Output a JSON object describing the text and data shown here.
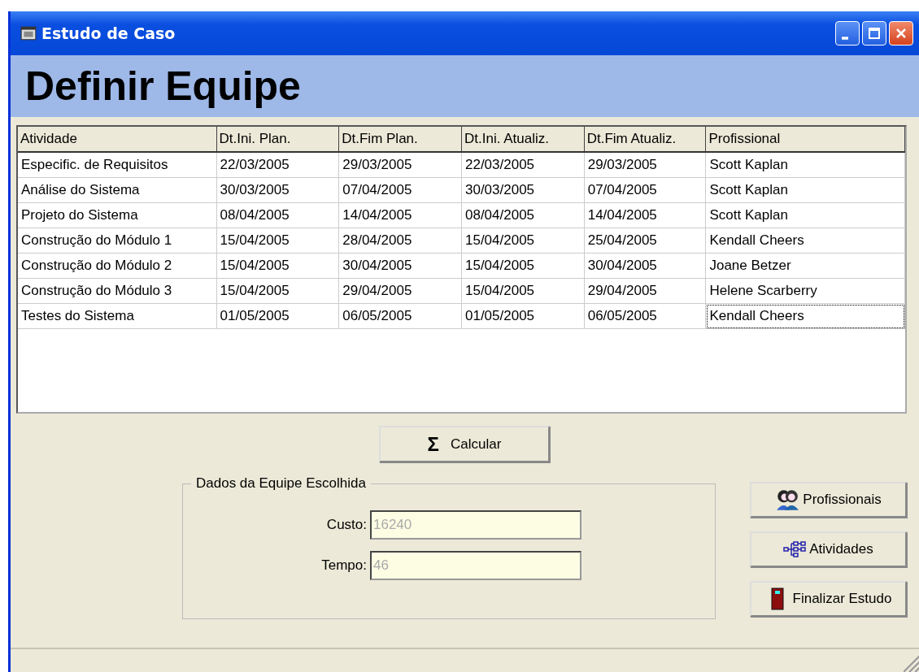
{
  "window": {
    "title": "Estudo de Caso"
  },
  "heading": "Definir Equipe",
  "table": {
    "columns": [
      "Atividade",
      "Dt.Ini. Plan.",
      "Dt.Fim Plan.",
      "Dt.Ini. Atualiz.",
      "Dt.Fim Atualiz.",
      "Profissional"
    ],
    "rows": [
      {
        "cells": [
          "Especific. de Requisitos",
          "22/03/2005",
          "29/03/2005",
          "22/03/2005",
          "29/03/2005",
          "Scott Kaplan"
        ],
        "focused": false
      },
      {
        "cells": [
          "Análise do Sistema",
          "30/03/2005",
          "07/04/2005",
          "30/03/2005",
          "07/04/2005",
          "Scott Kaplan"
        ],
        "focused": false
      },
      {
        "cells": [
          "Projeto do Sistema",
          "08/04/2005",
          "14/04/2005",
          "08/04/2005",
          "14/04/2005",
          "Scott Kaplan"
        ],
        "focused": false
      },
      {
        "cells": [
          "Construção do Módulo 1",
          "15/04/2005",
          "28/04/2005",
          "15/04/2005",
          "25/04/2005",
          "Kendall Cheers"
        ],
        "focused": false
      },
      {
        "cells": [
          "Construção do Módulo 2",
          "15/04/2005",
          "30/04/2005",
          "15/04/2005",
          "30/04/2005",
          "Joane Betzer"
        ],
        "focused": false
      },
      {
        "cells": [
          "Construção do Módulo 3",
          "15/04/2005",
          "29/04/2005",
          "15/04/2005",
          "29/04/2005",
          "Helene Scarberry"
        ],
        "focused": false
      },
      {
        "cells": [
          "Testes do Sistema",
          "01/05/2005",
          "06/05/2005",
          "01/05/2005",
          "06/05/2005",
          "Kendall Cheers"
        ],
        "focused": true
      }
    ]
  },
  "calculate_button": {
    "icon_glyph": "Σ",
    "label": "Calcular"
  },
  "group": {
    "title": "Dados da Equipe Escolhida",
    "fields": [
      {
        "label": "Custo:",
        "value": "16240",
        "disabled": true
      },
      {
        "label": "Tempo:",
        "value": "46",
        "disabled": true
      }
    ]
  },
  "side_buttons": [
    {
      "kind": "people",
      "label": "Profissionais"
    },
    {
      "kind": "tree",
      "label": "Atividades"
    },
    {
      "kind": "door",
      "label": "Finalizar Estudo"
    }
  ]
}
